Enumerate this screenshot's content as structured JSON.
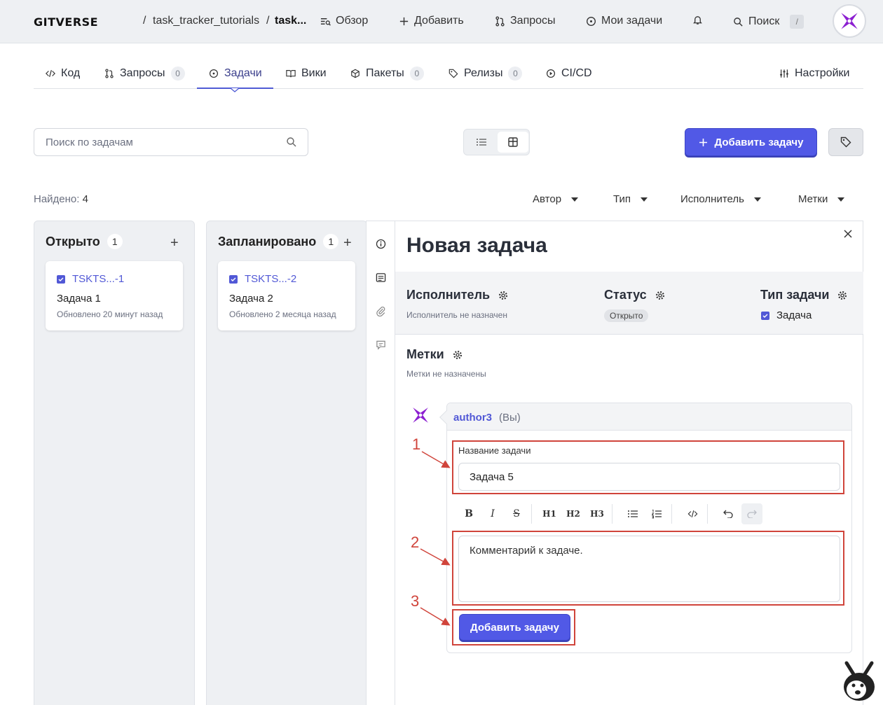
{
  "header": {
    "brand": "GITVERSE",
    "sep": "/",
    "breadcrumb_repo": "task_tracker_tutorials",
    "breadcrumb_current": "task...",
    "nav": [
      "Обзор",
      "Добавить",
      "Запросы",
      "Мои задачи",
      "Поиск"
    ],
    "search_shortcut": "/"
  },
  "tabs": [
    {
      "label": "Код",
      "count": ""
    },
    {
      "label": "Запросы",
      "count": "0"
    },
    {
      "label": "Задачи",
      "count": ""
    },
    {
      "label": "Вики",
      "count": ""
    },
    {
      "label": "Пакеты",
      "count": "0"
    },
    {
      "label": "Релизы",
      "count": "0"
    },
    {
      "label": "CI/CD",
      "count": ""
    }
  ],
  "settings_label": "Настройки",
  "toolbar": {
    "search_placeholder": "Поиск по задачам",
    "add_task_label": "Добавить задачу"
  },
  "results": {
    "found_label": "Найдено:",
    "found_count": "4"
  },
  "filters": [
    "Автор",
    "Тип",
    "Исполнитель",
    "Метки"
  ],
  "columns": [
    {
      "title": "Открыто",
      "count": "1",
      "card": {
        "id": "TSKTS...-1",
        "title": "Задача 1",
        "updated": "Обновлено 20 минут назад"
      }
    },
    {
      "title": "Запланировано",
      "count": "1",
      "card": {
        "id": "TSKTS...-2",
        "title": "Задача 2",
        "updated": "Обновлено 2 месяца назад"
      }
    }
  ],
  "panel": {
    "title": "Новая задача",
    "assignee_label": "Исполнитель",
    "assignee_value": "Исполнитель не назначен",
    "status_label": "Статус",
    "status_value": "Открыто",
    "type_label": "Тип задачи",
    "type_value": "Задача",
    "labels_label": "Метки",
    "labels_value": "Метки не назначены"
  },
  "comment": {
    "author": "author3",
    "you": "(Вы)",
    "field_label": "Название задачи",
    "title_value": "Задача 5",
    "format_buttons": [
      "B",
      "I",
      "S",
      "H1",
      "H2",
      "H3"
    ],
    "description_value": "Комментарий к задаче.",
    "submit_label": "Добавить задачу"
  },
  "annotations": [
    "1",
    "2",
    "3"
  ],
  "colors": {
    "accent": "#5159e6",
    "annotation": "#d0443b",
    "link": "#5158d6"
  }
}
